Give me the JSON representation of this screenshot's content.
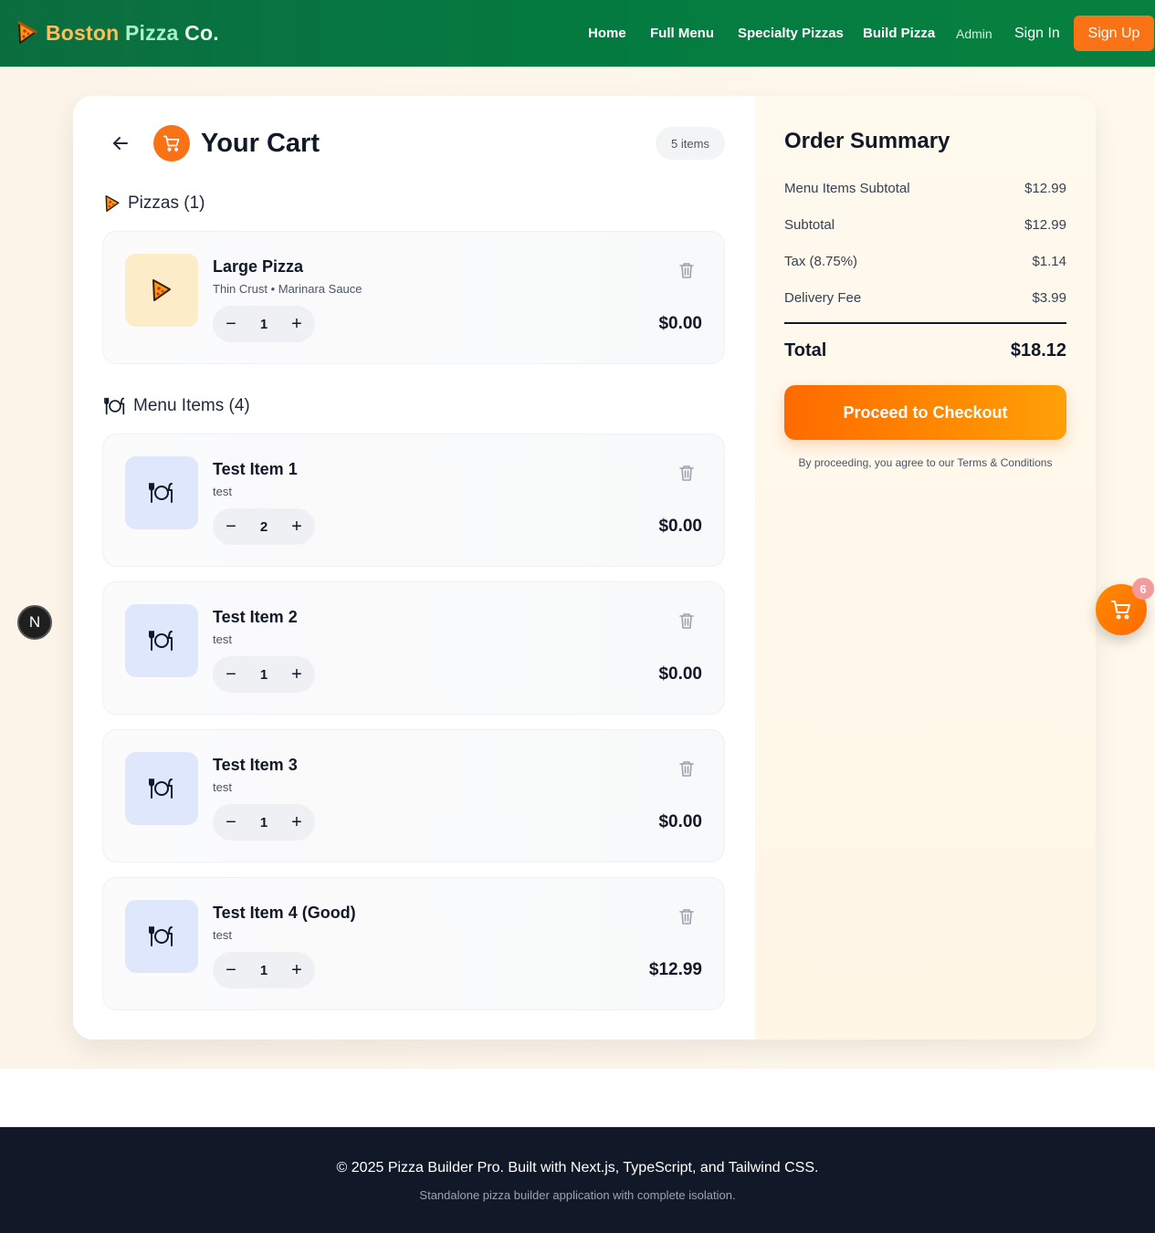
{
  "navbar": {
    "brand_word_1": "Boston",
    "brand_word_2": "Pizza",
    "brand_word_3": "Co.",
    "links": {
      "home": "Home",
      "full_menu": "Full Menu",
      "specialty": "Specialty Pizzas",
      "build": "Build Pizza",
      "admin": "Admin",
      "sign_in": "Sign In",
      "sign_up": "Sign Up"
    }
  },
  "cart": {
    "title": "Your Cart",
    "count_label": "5 items",
    "pizzas_heading": "Pizzas (1)",
    "menu_heading": "Menu Items (4)",
    "pizzas": [
      {
        "name": "Large Pizza",
        "desc": "Thin Crust • Marinara Sauce",
        "qty": "1",
        "price": "$0.00"
      }
    ],
    "menu_items": [
      {
        "name": "Test Item 1",
        "desc": "test",
        "qty": "2",
        "price": "$0.00"
      },
      {
        "name": "Test Item 2",
        "desc": "test",
        "qty": "1",
        "price": "$0.00"
      },
      {
        "name": "Test Item 3",
        "desc": "test",
        "qty": "1",
        "price": "$0.00"
      },
      {
        "name": "Test Item 4 (Good)",
        "desc": "test",
        "qty": "1",
        "price": "$12.99"
      }
    ],
    "qty_minus": "−",
    "qty_plus": "+"
  },
  "summary": {
    "title": "Order Summary",
    "rows": [
      {
        "label": "Menu Items Subtotal",
        "value": "$12.99"
      },
      {
        "label": "Subtotal",
        "value": "$12.99"
      },
      {
        "label": "Tax (8.75%)",
        "value": "$1.14"
      },
      {
        "label": "Delivery Fee",
        "value": "$3.99"
      }
    ],
    "total_label": "Total",
    "total_value": "$18.12",
    "checkout_label": "Proceed to Checkout",
    "terms": "By proceeding, you agree to our Terms & Conditions"
  },
  "floating": {
    "n_badge": "N",
    "cart_count": "6"
  },
  "footer": {
    "line1": "© 2025 Pizza Builder Pro. Built with Next.js, TypeScript, and Tailwind CSS.",
    "line2": "Standalone pizza builder application with complete isolation."
  },
  "colors": {
    "nav_green": "#047a40",
    "accent_orange": "#f97316",
    "footer_dark": "#111827"
  },
  "icons": {
    "brand": "pizza-slice-icon",
    "back": "arrow-left-icon",
    "cart": "shopping-cart-icon",
    "menu_item": "plate-cutlery-icon",
    "remove": "trash-icon"
  }
}
